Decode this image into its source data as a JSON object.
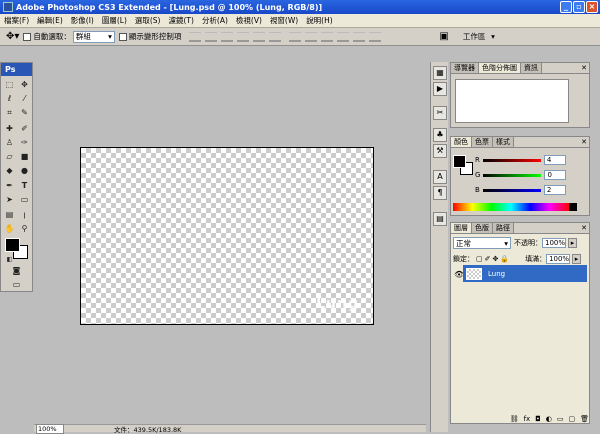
{
  "window": {
    "title": "Adobe Photoshop CS3 Extended - [Lung.psd @ 100% (Lung, RGB/8)]"
  },
  "menu": [
    "檔案(F)",
    "編輯(E)",
    "影像(I)",
    "圖層(L)",
    "選取(S)",
    "濾鏡(T)",
    "分析(A)",
    "檢視(V)",
    "視窗(W)",
    "說明(H)"
  ],
  "options": {
    "auto_select_label": "自動選取：",
    "auto_select_value": "群組",
    "transform_label": "顯示變形控制項",
    "workspace_label": "工作區"
  },
  "toolbox": {
    "badge": "Ps"
  },
  "canvas": {
    "text": "Lung"
  },
  "status": {
    "zoom": "100%",
    "doc_label": "文件：439.5K/183.8K"
  },
  "panels": {
    "navigator_tabs": [
      "導覽器",
      "色階分佈圖",
      "資訊"
    ],
    "color_tabs": [
      "顏色",
      "色票",
      "樣式"
    ],
    "color": {
      "r_label": "R",
      "r": "4",
      "g_label": "G",
      "g": "0",
      "b_label": "B",
      "b": "2"
    },
    "layers_tabs": [
      "圖層",
      "色版",
      "路徑"
    ],
    "blend_mode": "正常",
    "opacity_label": "不透明：",
    "opacity": "100%",
    "lock_label": "鎖定：",
    "fill_label": "填滿：",
    "fill": "100%",
    "layer_name": "Lung"
  }
}
